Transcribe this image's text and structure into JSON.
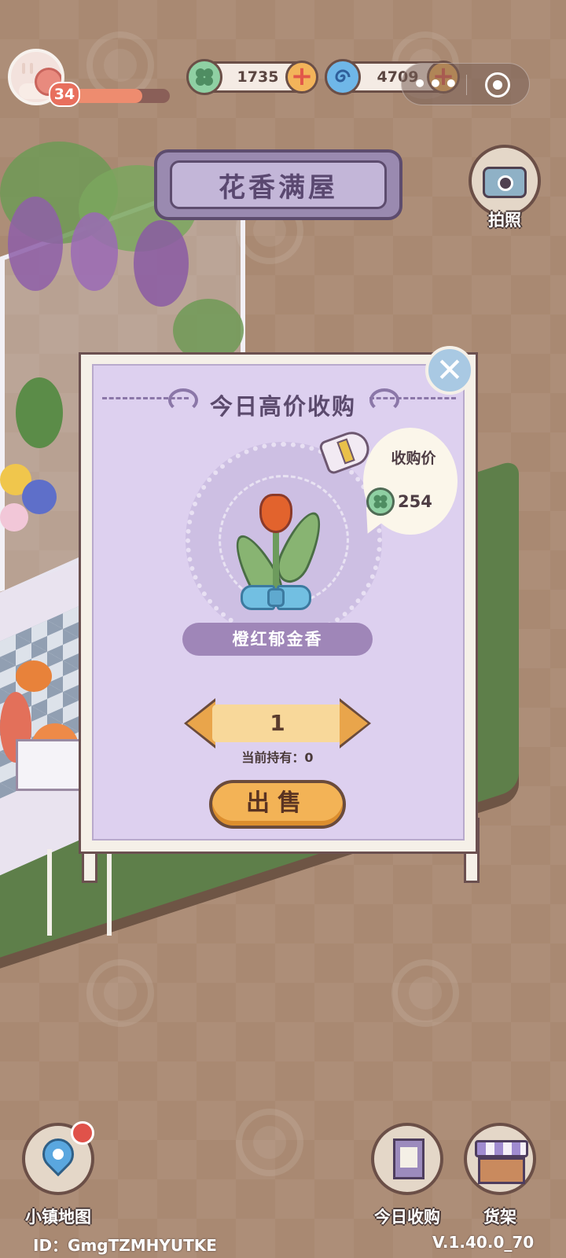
{
  "header": {
    "level": "34",
    "xp_fraction": 0.72,
    "clover_amount": "1735",
    "swirl_amount": "4709",
    "plus_symbol": "+",
    "capsule_more": "•••"
  },
  "title_plaque": {
    "text": "花香满屋"
  },
  "camera": {
    "label": "拍照"
  },
  "dialog": {
    "title": "今日高价收购",
    "close_symbol": "✕",
    "price_label": "收购价",
    "price_value": "254",
    "item_name": "橙红郁金香",
    "quantity": "1",
    "owned_text": "当前持有：0",
    "sell_label": "出售"
  },
  "bottom": {
    "map_label": "小镇地图",
    "today_buy_label": "今日收购",
    "shelf_label": "货架"
  },
  "footer": {
    "id_text": "ID：GmgTZMHYUTKE",
    "version": "V.1.40.0_70"
  },
  "colors": {
    "background": "#a98972",
    "dialog_lavender": "#ddd0ef",
    "button_orange": "#f3b356",
    "clover_green": "#8fd0a3",
    "swirl_blue": "#6fb7e8"
  }
}
